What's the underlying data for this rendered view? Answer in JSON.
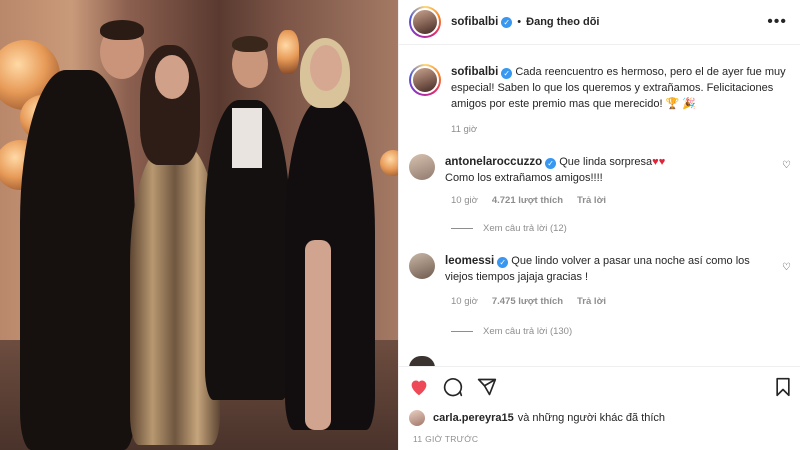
{
  "header": {
    "username": "sofibalbi",
    "separator": "•",
    "follow_state": "Đang theo dõi",
    "more_glyph": "•••"
  },
  "caption": {
    "username": "sofibalbi",
    "text": "Cada reencuentro es hermoso, pero el de ayer fue muy especial! Saben lo que los queremos y extrañamos. Felicitaciones amigos por este premio mas que merecido! 🏆 🎉",
    "time": "11 giờ"
  },
  "comments": [
    {
      "username": "antonelaroccuzzo",
      "text_1": "Que linda sorpresa",
      "hearts": "♥♥",
      "text_2": "Como los extrañamos amigos!!!!",
      "time": "10 giờ",
      "likes": "4.721 lượt thích",
      "reply": "Trả lời",
      "view_replies": "Xem câu trả lời (12)"
    },
    {
      "username": "leomessi",
      "text": "Que lindo volver a pasar una noche así como los viejos tiempos jajaja gracias !",
      "time": "10 giờ",
      "likes": "7.475 lượt thích",
      "reply": "Trả lời",
      "view_replies": "Xem câu trả lời (130)"
    }
  ],
  "footer": {
    "liked_by_user": "carla.pereyra15",
    "liked_by_rest": "và những người khác đã thích",
    "time_ago": "11 GIỜ TRƯỚC"
  },
  "colors": {
    "verified": "#3897f0",
    "like_active": "#ed4956",
    "muted_text": "#8e8e8e"
  },
  "icons": [
    "heart-icon",
    "comment-icon",
    "share-icon",
    "bookmark-icon",
    "verified-icon",
    "more-icon"
  ]
}
